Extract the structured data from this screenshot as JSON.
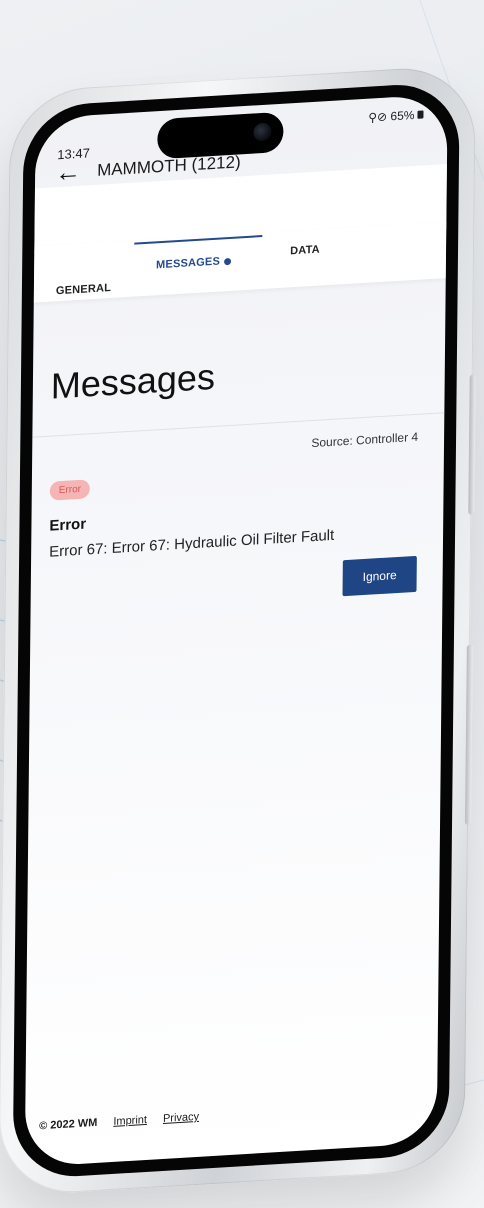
{
  "status_bar": {
    "time": "13:47",
    "icons_text": "⚲⊘ 65%"
  },
  "header": {
    "back_icon": "arrow-left-icon",
    "title": "MAMMOTH (1212)"
  },
  "tabs": [
    {
      "label": "GENERAL",
      "active": false
    },
    {
      "label": "MESSAGES",
      "active": true,
      "has_dot": true
    },
    {
      "label": "DATA",
      "active": false
    }
  ],
  "page": {
    "title": "Messages"
  },
  "message": {
    "source": "Source: Controller 4",
    "badge": "Error",
    "title": "Error",
    "text": "Error 67: Error 67: Hydraulic Oil Filter Fault",
    "action_label": "Ignore"
  },
  "footer": {
    "copyright": "© 2022 WM",
    "imprint": "Imprint",
    "privacy": "Privacy"
  },
  "colors": {
    "accent": "#234b8c",
    "button": "#1f4585",
    "badge_bg": "#f6b5b5",
    "badge_text": "#d65a5a"
  }
}
